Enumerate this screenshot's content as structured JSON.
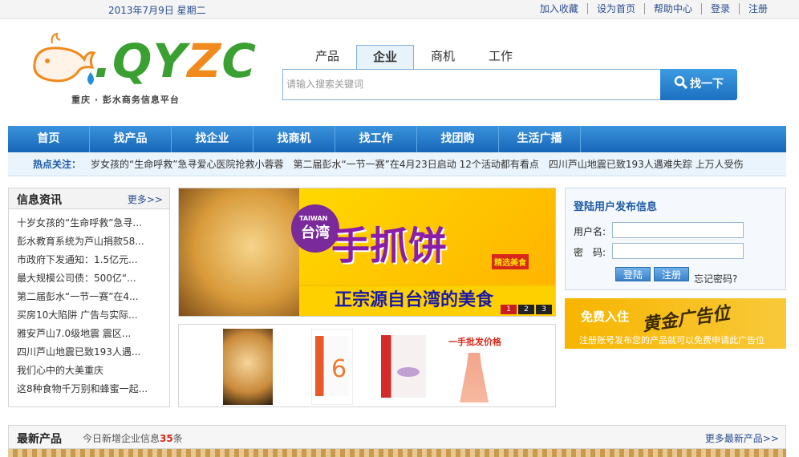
{
  "topbar": {
    "date": "2013年7月9日  星期二",
    "links": [
      "加入收藏",
      "设为首页",
      "帮助中心",
      "登录",
      "注册"
    ]
  },
  "logo": {
    "text_q": ".Q",
    "text_y": "Y",
    "text_z": "Z",
    "text_c": "C",
    "subtitle": "重庆 · 彭水商务信息平台"
  },
  "search": {
    "tabs": [
      "产品",
      "企业",
      "商机",
      "工作"
    ],
    "active_tab": "企业",
    "placeholder": "请输入搜索关键词",
    "button_label": "找一下"
  },
  "nav": {
    "items": [
      "首页",
      "找产品",
      "找企业",
      "找商机",
      "找工作",
      "找团购",
      "生活广播"
    ]
  },
  "hot": {
    "label": "热点关注：",
    "items": [
      "岁女孩的“生命呼救”急寻爱心医院抢救小蓉蓉",
      "第二届彭水“一节一赛”在4月23日启动 12个活动都有看点",
      "四川芦山地震已致193人遇难失踪 上万人受伤"
    ]
  },
  "news": {
    "title": "信息资讯",
    "more": "更多>>",
    "items": [
      "十岁女孩的“生命呼救”急寻...",
      "彭水教育系统为芦山捐款58...",
      "市政府下发通知：1.5亿元...",
      "最大规模公司债：500亿“...",
      "第二届彭水“一节一赛”在4...",
      "买房10大陷阱 广告与实际...",
      "雅安芦山7.0级地震 震区...",
      "四川芦山地震已致193人遇...",
      "我们心中的大美重庆",
      "这8种食物千万别和蜂蜜一起..."
    ]
  },
  "banner": {
    "badge_top": "TAIWAN",
    "badge": "台湾",
    "headline": "手抓饼",
    "tag": "精选美食",
    "slogan": "正宗源自台湾的美食",
    "pages": [
      "1",
      "2",
      "3"
    ]
  },
  "thumbs": {
    "dress_label": "一手批发价格",
    "box_number": "6"
  },
  "login": {
    "title": "登陆用户发布信息",
    "username_label": "用户名:",
    "password_label": "密　码:",
    "login_button": "登陆",
    "register_button": "注册",
    "forgot": "忘记密码?"
  },
  "ad": {
    "line1": "免费入住",
    "line2": "黄金广告位",
    "line3": "注册账号发布您的产品就可以免费申请此广告位"
  },
  "latest": {
    "title": "最新产品",
    "subtitle_prefix": "今日新增企业信息",
    "count": "35",
    "subtitle_suffix": "条",
    "more": "更多最新产品>>"
  },
  "colors": {
    "nav_blue": "#1766b8",
    "link_blue": "#2a4d8f",
    "accent_red": "#d8281a",
    "logo_green": "#3aa032",
    "logo_orange": "#f08a1c"
  }
}
